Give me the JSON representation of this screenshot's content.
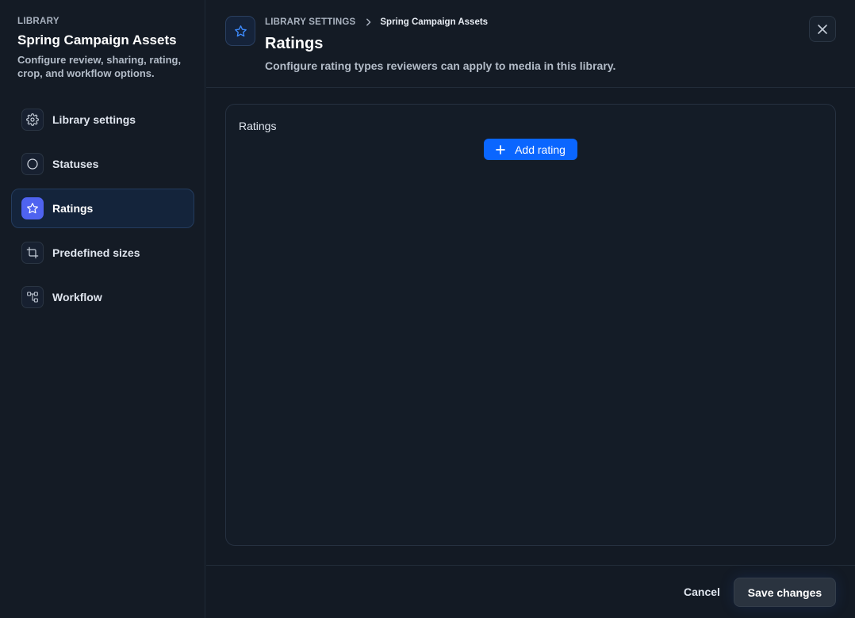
{
  "sidebar": {
    "eyebrow": "LIBRARY",
    "title": "Spring Campaign Assets",
    "description": "Configure review, sharing, rating, crop, and workflow options.",
    "items": [
      {
        "label": "Library settings",
        "icon": "gear-icon"
      },
      {
        "label": "Statuses",
        "icon": "circle-icon"
      },
      {
        "label": "Ratings",
        "icon": "star-icon",
        "active": true
      },
      {
        "label": "Predefined sizes",
        "icon": "crop-icon"
      },
      {
        "label": "Workflow",
        "icon": "workflow-icon"
      }
    ]
  },
  "header": {
    "breadcrumb": [
      "LIBRARY SETTINGS",
      "Spring Campaign Assets"
    ],
    "title": "Ratings",
    "description": "Configure rating types reviewers can apply to media in this library.",
    "icon": "star-icon"
  },
  "panel": {
    "label": "Ratings",
    "add_label": "Add rating"
  },
  "footer": {
    "cancel_label": "Cancel",
    "save_label": "Save changes"
  },
  "colors": {
    "accent": "#0a66ff",
    "active_icon": "#4f63f0",
    "background": "#131a24"
  }
}
